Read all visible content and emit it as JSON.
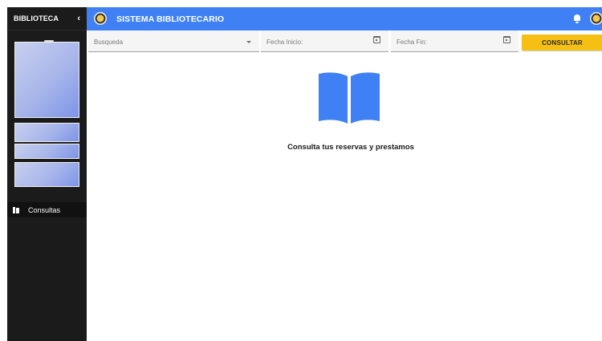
{
  "sidebar": {
    "title": "BIBLIOTECA",
    "collapse_icon": "chevron-left-icon",
    "menu": [
      {
        "label": "Consultas",
        "icon": "book-icon"
      }
    ]
  },
  "topbar": {
    "app_title": "SISTEMA BIBLIOTECARIO",
    "notifications_icon": "bell-icon",
    "accent": "#3f81f4"
  },
  "filters": {
    "search": {
      "placeholder": "Busqueda"
    },
    "start_date": {
      "placeholder": "Fecha Inicio:"
    },
    "end_date": {
      "placeholder": "Fecha Fin:"
    },
    "submit_label": "CONSULTAR",
    "submit_color": "#f5c013"
  },
  "empty_state": {
    "icon": "open-book-icon",
    "message": "Consulta tus reservas y prestamos"
  }
}
